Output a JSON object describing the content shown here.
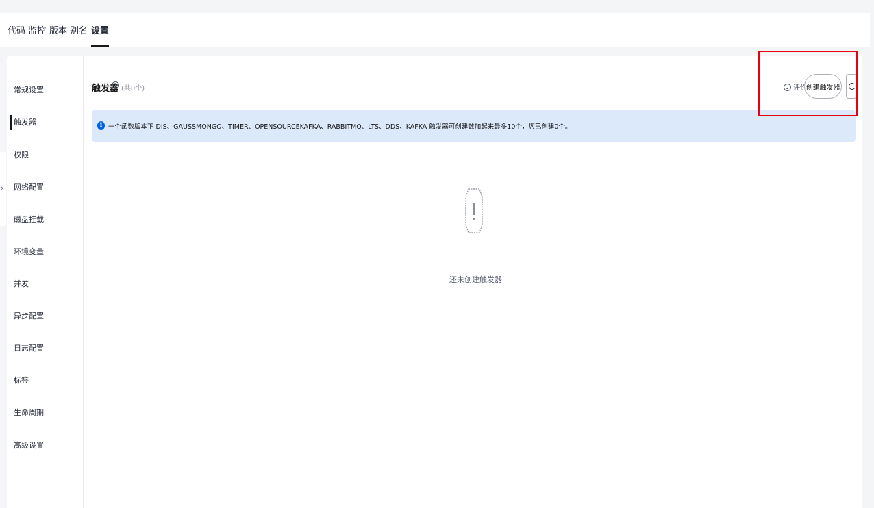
{
  "tabs": [
    "代码",
    "监控",
    "版本",
    "别名",
    "设置"
  ],
  "active_tab": "设置",
  "sidebar": {
    "items": [
      "常规设置",
      "触发器",
      "权限",
      "网络配置",
      "磁盘挂载",
      "环境变量",
      "并发",
      "异步配置",
      "日志配置",
      "标签",
      "生命周期",
      "高级设置"
    ],
    "active": "触发器"
  },
  "main": {
    "title": "触发器",
    "count_text": "(共0个)",
    "rating_label": "评价",
    "create_button": "创建触发器",
    "info_text": "一个函数版本下 DIS、GAUSSMONGO、TIMER、OPENSOURCEKAFKA、RABBITMQ、LTS、DDS、KAFKA 触发器可创建数加起来最多10个，您已创建0个。",
    "empty_text": "还未创建触发器"
  },
  "colors": {
    "info_bg": "#dce9fb",
    "info_icon": "#0062de",
    "highlight": "#e60012"
  }
}
